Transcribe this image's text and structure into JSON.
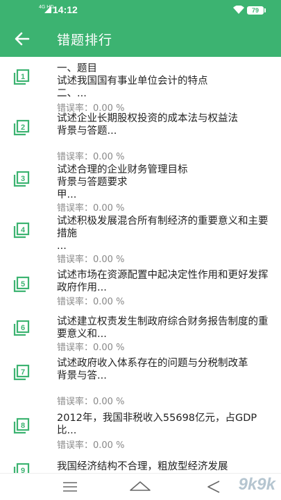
{
  "status_bar": {
    "network": "4G HD",
    "time": "14:12",
    "battery": "79",
    "accent": "#3cb371"
  },
  "toolbar": {
    "back_icon": "arrow-left-icon",
    "title": "错题排行"
  },
  "items": [
    {
      "num": "1",
      "text": "一、题目\n试述我国国有事业单位会计的特点\n二、...",
      "error": "错误率：0.00 %"
    },
    {
      "num": "2",
      "text": "试述企业长期股权投资的成本法与权益法\n背景与答题...",
      "error": "错误率：0.00 %"
    },
    {
      "num": "3",
      "text": "试述合理的企业财务管理目标\n背景与答题要求\n甲...",
      "error": "错误率：0.00 %"
    },
    {
      "num": "4",
      "text": "试述积极发展混合所有制经济的重要意义和主要措施\n...",
      "error": "错误率：0.00 %"
    },
    {
      "num": "5",
      "text": "试述市场在资源配置中起决定性作用和更好发挥政府作用...",
      "error": "错误率：0.00 %"
    },
    {
      "num": "6",
      "text": "试述建立权责发生制政府综合财务报告制度的重要意义和...",
      "error": "错误率：0.00 %"
    },
    {
      "num": "7",
      "text": "试述政府收入体系存在的问题与分税制改革\n背景与答...",
      "error": "错误率：0.00 %"
    },
    {
      "num": "8",
      "text": "2012年，我国非税收入55698亿元，占GDP比...",
      "error": "错误率：0.00 %"
    },
    {
      "num": "9",
      "text": "我国经济结构不合理，粗放型经济发展",
      "error": ""
    }
  ],
  "nav": {
    "menu_icon": "menu-icon",
    "home_icon": "home-icon",
    "back_icon": "back-icon"
  },
  "watermark": "9k9k"
}
